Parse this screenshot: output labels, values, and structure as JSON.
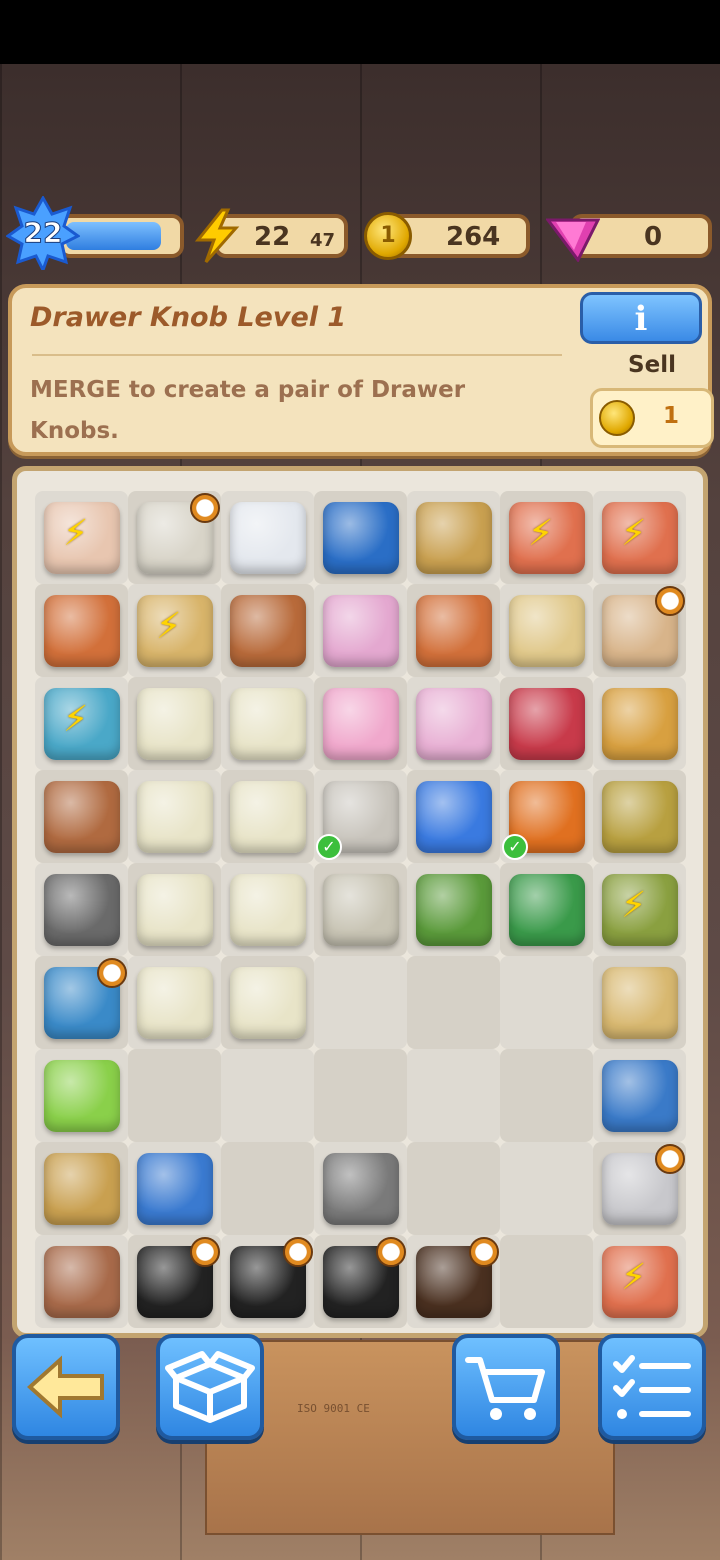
{
  "hud": {
    "level": "22",
    "xp_fraction": 0.86,
    "energy": "22",
    "energy_timer": "47",
    "coins": "264",
    "gems": "0"
  },
  "info": {
    "title": "Drawer Knob Level 1",
    "description": "MERGE to create a pair of Drawer Knobs.",
    "info_button_label": "i",
    "sell_label": "Sell",
    "sell_price": "1"
  },
  "board": {
    "items": [
      {
        "r": 0,
        "c": 0,
        "name": "clay-pot-icon",
        "color": "#e8c6b0",
        "bolt": true
      },
      {
        "r": 0,
        "c": 1,
        "name": "wooden-cabinet-icon",
        "color": "#d8d4c8",
        "timer": true
      },
      {
        "r": 0,
        "c": 2,
        "name": "plastic-bottle-icon",
        "color": "#e4e8ee"
      },
      {
        "r": 0,
        "c": 3,
        "name": "blue-cabinet-icon",
        "color": "#2a6ec6"
      },
      {
        "r": 0,
        "c": 4,
        "name": "sack-icon",
        "color": "#c9a050"
      },
      {
        "r": 0,
        "c": 5,
        "name": "toy-race-car-icon",
        "color": "#e0704e",
        "bolt": true
      },
      {
        "r": 0,
        "c": 6,
        "name": "toy-race-car-icon",
        "color": "#e0704e",
        "bolt": true
      },
      {
        "r": 1,
        "c": 0,
        "name": "terracotta-pot-icon",
        "color": "#d2703a"
      },
      {
        "r": 1,
        "c": 1,
        "name": "wooden-crate-icon",
        "color": "#d8b46a",
        "bolt": true
      },
      {
        "r": 1,
        "c": 2,
        "name": "broken-pot-shard-icon",
        "color": "#b86a3a"
      },
      {
        "r": 1,
        "c": 3,
        "name": "spray-bottle-icon",
        "color": "#e4a8d0"
      },
      {
        "r": 1,
        "c": 4,
        "name": "terracotta-pot-icon",
        "color": "#d2703a"
      },
      {
        "r": 1,
        "c": 5,
        "name": "soap-bar-icon",
        "color": "#e0c88a"
      },
      {
        "r": 1,
        "c": 6,
        "name": "dresser-icon",
        "color": "#d8b48a",
        "timer": true
      },
      {
        "r": 2,
        "c": 0,
        "name": "soil-pot-icon",
        "color": "#4aa8c8",
        "bolt": true
      },
      {
        "r": 2,
        "c": 1,
        "name": "garden-gloves-icon",
        "color": "#e8e4c8"
      },
      {
        "r": 2,
        "c": 2,
        "name": "garden-gloves-icon",
        "color": "#e8e4c8"
      },
      {
        "r": 2,
        "c": 3,
        "name": "pink-bucket-icon",
        "color": "#f0a8cc"
      },
      {
        "r": 2,
        "c": 4,
        "name": "dustpan-brush-icon",
        "color": "#e8b0d4"
      },
      {
        "r": 2,
        "c": 5,
        "name": "plunger-icon",
        "color": "#c83a4a"
      },
      {
        "r": 2,
        "c": 6,
        "name": "drawer-knob-icon",
        "color": "#d8a040"
      },
      {
        "r": 3,
        "c": 0,
        "name": "leather-gloves-icon",
        "color": "#b06a40"
      },
      {
        "r": 3,
        "c": 1,
        "name": "garden-gloves-icon",
        "color": "#e8e4c8"
      },
      {
        "r": 3,
        "c": 2,
        "name": "garden-gloves-icon",
        "color": "#e8e4c8"
      },
      {
        "r": 3,
        "c": 3,
        "name": "screw-box-icon",
        "color": "#c8c4bc",
        "check": true
      },
      {
        "r": 3,
        "c": 4,
        "name": "spray-paint-can-icon",
        "color": "#3a7ae0"
      },
      {
        "r": 3,
        "c": 5,
        "name": "wire-cutters-icon",
        "color": "#e07020",
        "check": true
      },
      {
        "r": 3,
        "c": 6,
        "name": "watering-spout-icon",
        "color": "#b8a040"
      },
      {
        "r": 4,
        "c": 0,
        "name": "gravel-pile-icon",
        "color": "#6a6a6a"
      },
      {
        "r": 4,
        "c": 1,
        "name": "garden-gloves-icon",
        "color": "#e8e4c8"
      },
      {
        "r": 4,
        "c": 2,
        "name": "garden-gloves-icon",
        "color": "#e8e4c8"
      },
      {
        "r": 4,
        "c": 3,
        "name": "paint-tin-icon",
        "color": "#c8c4b4"
      },
      {
        "r": 4,
        "c": 4,
        "name": "axe-icon",
        "color": "#5a9a3a"
      },
      {
        "r": 4,
        "c": 5,
        "name": "pruning-shears-icon",
        "color": "#3a9a4a"
      },
      {
        "r": 4,
        "c": 6,
        "name": "garden-tools-bucket-icon",
        "color": "#8aa040",
        "bolt": true
      },
      {
        "r": 5,
        "c": 0,
        "name": "toolbox-icon",
        "color": "#3a8ac8",
        "timer": true
      },
      {
        "r": 5,
        "c": 1,
        "name": "garden-gloves-icon",
        "color": "#e8e4c8"
      },
      {
        "r": 5,
        "c": 2,
        "name": "garden-gloves-icon",
        "color": "#e8e4c8"
      },
      {
        "r": 5,
        "c": 6,
        "name": "mop-icon",
        "color": "#d8b870"
      },
      {
        "r": 6,
        "c": 0,
        "name": "paint-bucket-icon",
        "color": "#8ad04a"
      },
      {
        "r": 6,
        "c": 6,
        "name": "warehouse-icon",
        "color": "#3a7ac8"
      },
      {
        "r": 7,
        "c": 0,
        "name": "sack-icon",
        "color": "#c9a050"
      },
      {
        "r": 7,
        "c": 1,
        "name": "money-bag-icon",
        "color": "#3a7ad0"
      },
      {
        "r": 7,
        "c": 3,
        "name": "screw-icon",
        "color": "#7a7a7a"
      },
      {
        "r": 7,
        "c": 6,
        "name": "hand-mirror-icon",
        "color": "#c8c8cc",
        "timer": true
      },
      {
        "r": 8,
        "c": 0,
        "name": "feather-duster-icon",
        "color": "#a86a4a"
      },
      {
        "r": 8,
        "c": 1,
        "name": "makeup-brush-icon",
        "color": "#222222",
        "timer": true
      },
      {
        "r": 8,
        "c": 2,
        "name": "makeup-brush-icon",
        "color": "#222222",
        "timer": true
      },
      {
        "r": 8,
        "c": 3,
        "name": "makeup-brush-icon",
        "color": "#222222",
        "timer": true
      },
      {
        "r": 8,
        "c": 4,
        "name": "makeup-brush-icon",
        "color": "#4a3020",
        "timer": true
      },
      {
        "r": 8,
        "c": 6,
        "name": "toy-race-car-icon",
        "color": "#e0704e",
        "bolt": true
      }
    ]
  },
  "bottom_nav": [
    {
      "name": "back-button",
      "icon": "arrow-left-icon"
    },
    {
      "name": "storage-box-button",
      "icon": "box-icon"
    },
    {
      "name": "shop-button",
      "icon": "cart-icon"
    },
    {
      "name": "tasks-button",
      "icon": "checklist-icon"
    }
  ]
}
